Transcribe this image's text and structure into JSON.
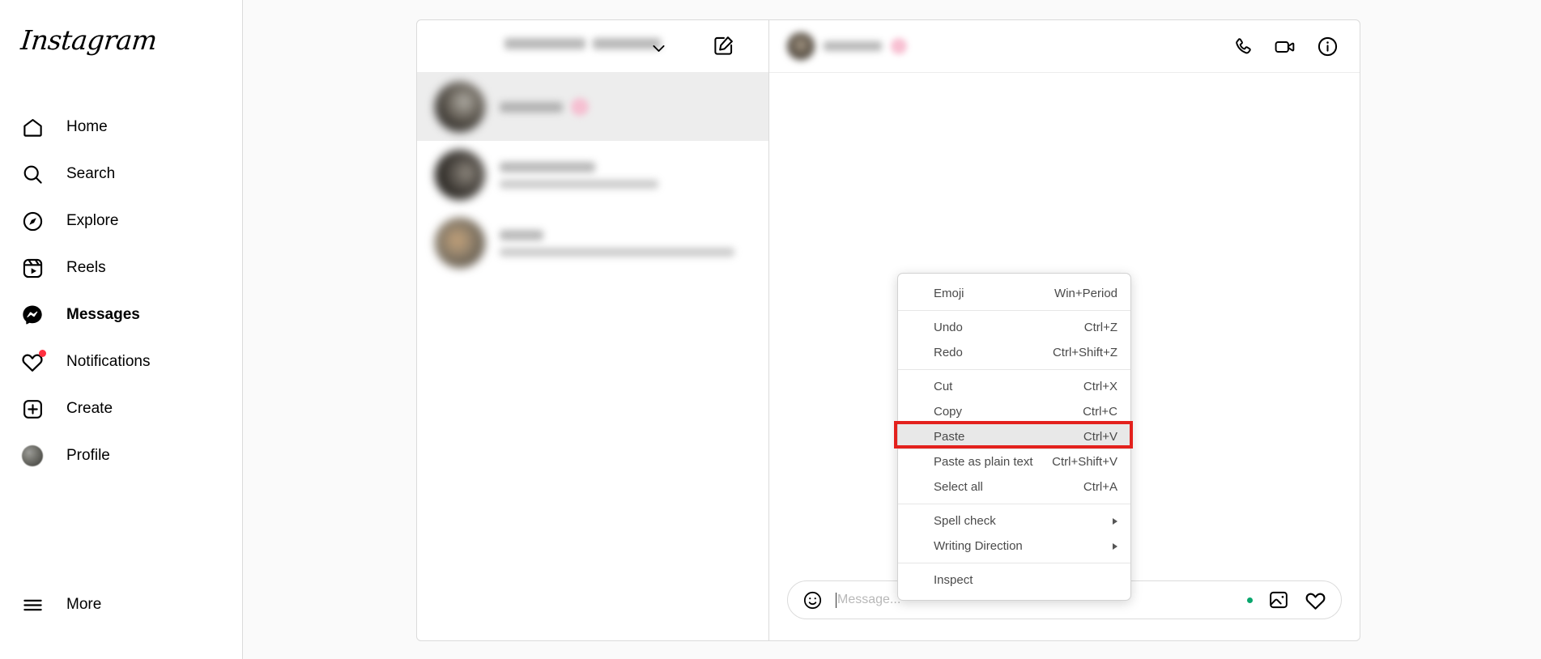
{
  "brand": {
    "name": "Instagram",
    "accent": "#ff3040",
    "online_dot": "#09a66d"
  },
  "sidebar": {
    "logo": "Instagram",
    "items": [
      {
        "label": "Home",
        "icon": "home-icon",
        "active": false
      },
      {
        "label": "Search",
        "icon": "search-icon",
        "active": false
      },
      {
        "label": "Explore",
        "icon": "compass-icon",
        "active": false
      },
      {
        "label": "Reels",
        "icon": "reels-icon",
        "active": false
      },
      {
        "label": "Messages",
        "icon": "messenger-icon",
        "active": true
      },
      {
        "label": "Notifications",
        "icon": "heart-icon",
        "active": false,
        "badge": true
      },
      {
        "label": "Create",
        "icon": "plus-square-icon",
        "active": false
      },
      {
        "label": "Profile",
        "icon": "avatar",
        "active": false
      }
    ],
    "more": {
      "label": "More",
      "icon": "hamburger-icon"
    }
  },
  "conversations_panel": {
    "header": {
      "username": "",
      "username_redacted": true,
      "chevron_icon": "chevron-down-icon",
      "new_message_icon": "new-message-icon"
    },
    "rows": [
      {
        "name": "",
        "preview": "",
        "redacted": true,
        "selected": true,
        "has_pink_badge": true
      },
      {
        "name": "",
        "preview": "",
        "redacted": true,
        "selected": false,
        "has_pink_badge": false
      },
      {
        "name": "",
        "preview": "",
        "redacted": true,
        "selected": false,
        "has_pink_badge": false
      }
    ]
  },
  "chat_panel": {
    "header": {
      "name": "",
      "redacted": true,
      "has_pink_badge": true,
      "actions": [
        {
          "label": "Audio call",
          "icon": "phone-icon"
        },
        {
          "label": "Video call",
          "icon": "video-camera-icon"
        },
        {
          "label": "Conversation information",
          "icon": "info-circle-icon"
        }
      ]
    },
    "composer": {
      "emoji_icon": "smiley-icon",
      "placeholder": "Message...",
      "value": "",
      "right_icons": [
        {
          "label": "Online status",
          "icon": "green-status-dot"
        },
        {
          "label": "Send photo",
          "icon": "image-icon"
        },
        {
          "label": "Send like",
          "icon": "heart-outline-icon"
        }
      ]
    }
  },
  "context_menu": {
    "highlighted_item": "Paste",
    "highlight_outline_color": "#e3211d",
    "groups": [
      {
        "items": [
          {
            "label": "Emoji",
            "accel": "Win+Period",
            "submenu": false,
            "highlight": false
          }
        ]
      },
      {
        "items": [
          {
            "label": "Undo",
            "accel": "Ctrl+Z",
            "submenu": false,
            "highlight": false
          },
          {
            "label": "Redo",
            "accel": "Ctrl+Shift+Z",
            "submenu": false,
            "highlight": false
          }
        ]
      },
      {
        "items": [
          {
            "label": "Cut",
            "accel": "Ctrl+X",
            "submenu": false,
            "highlight": false
          },
          {
            "label": "Copy",
            "accel": "Ctrl+C",
            "submenu": false,
            "highlight": false
          },
          {
            "label": "Paste",
            "accel": "Ctrl+V",
            "submenu": false,
            "highlight": true
          },
          {
            "label": "Paste as plain text",
            "accel": "Ctrl+Shift+V",
            "submenu": false,
            "highlight": false
          },
          {
            "label": "Select all",
            "accel": "Ctrl+A",
            "submenu": false,
            "highlight": false
          }
        ]
      },
      {
        "items": [
          {
            "label": "Spell check",
            "accel": "",
            "submenu": true,
            "highlight": false
          },
          {
            "label": "Writing Direction",
            "accel": "",
            "submenu": true,
            "highlight": false
          }
        ]
      },
      {
        "items": [
          {
            "label": "Inspect",
            "accel": "",
            "submenu": false,
            "highlight": false
          }
        ]
      }
    ]
  }
}
